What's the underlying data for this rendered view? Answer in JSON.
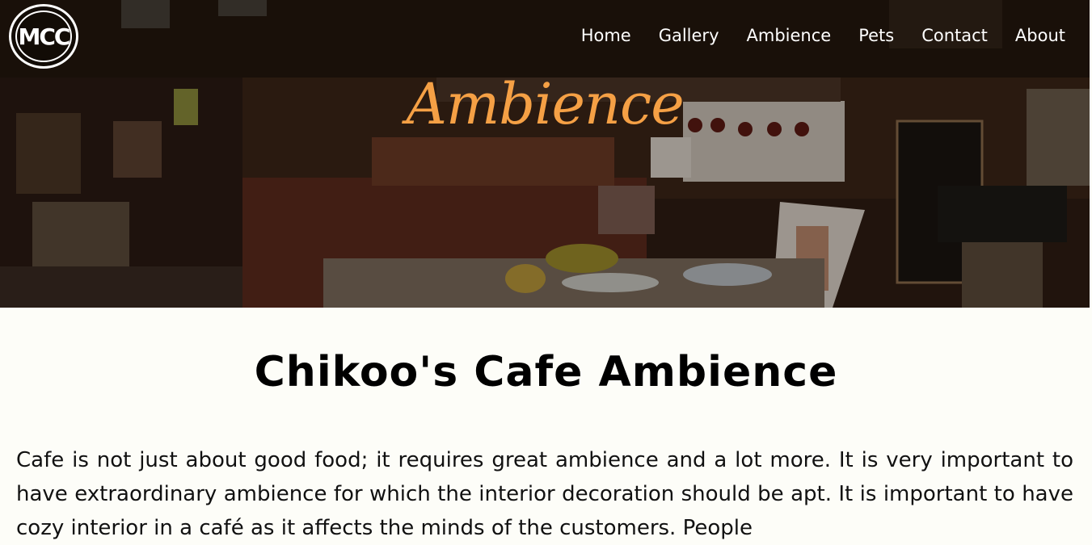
{
  "logo": {
    "text": "MCC"
  },
  "nav": {
    "items": [
      {
        "label": "Home"
      },
      {
        "label": "Gallery"
      },
      {
        "label": "Ambience"
      },
      {
        "label": "Pets"
      },
      {
        "label": "Contact"
      },
      {
        "label": "About"
      }
    ]
  },
  "hero": {
    "title": "Ambience",
    "title_color": "#f5a045"
  },
  "main": {
    "title": "Chikoo's Cafe Ambience",
    "intro": "Cafe is not just about good food; it requires great ambience and a lot more. It is very important to have extraordinary ambience for which the interior decoration should be apt. It is important to have cozy interior in a café as it affects the minds of the customers. People"
  }
}
